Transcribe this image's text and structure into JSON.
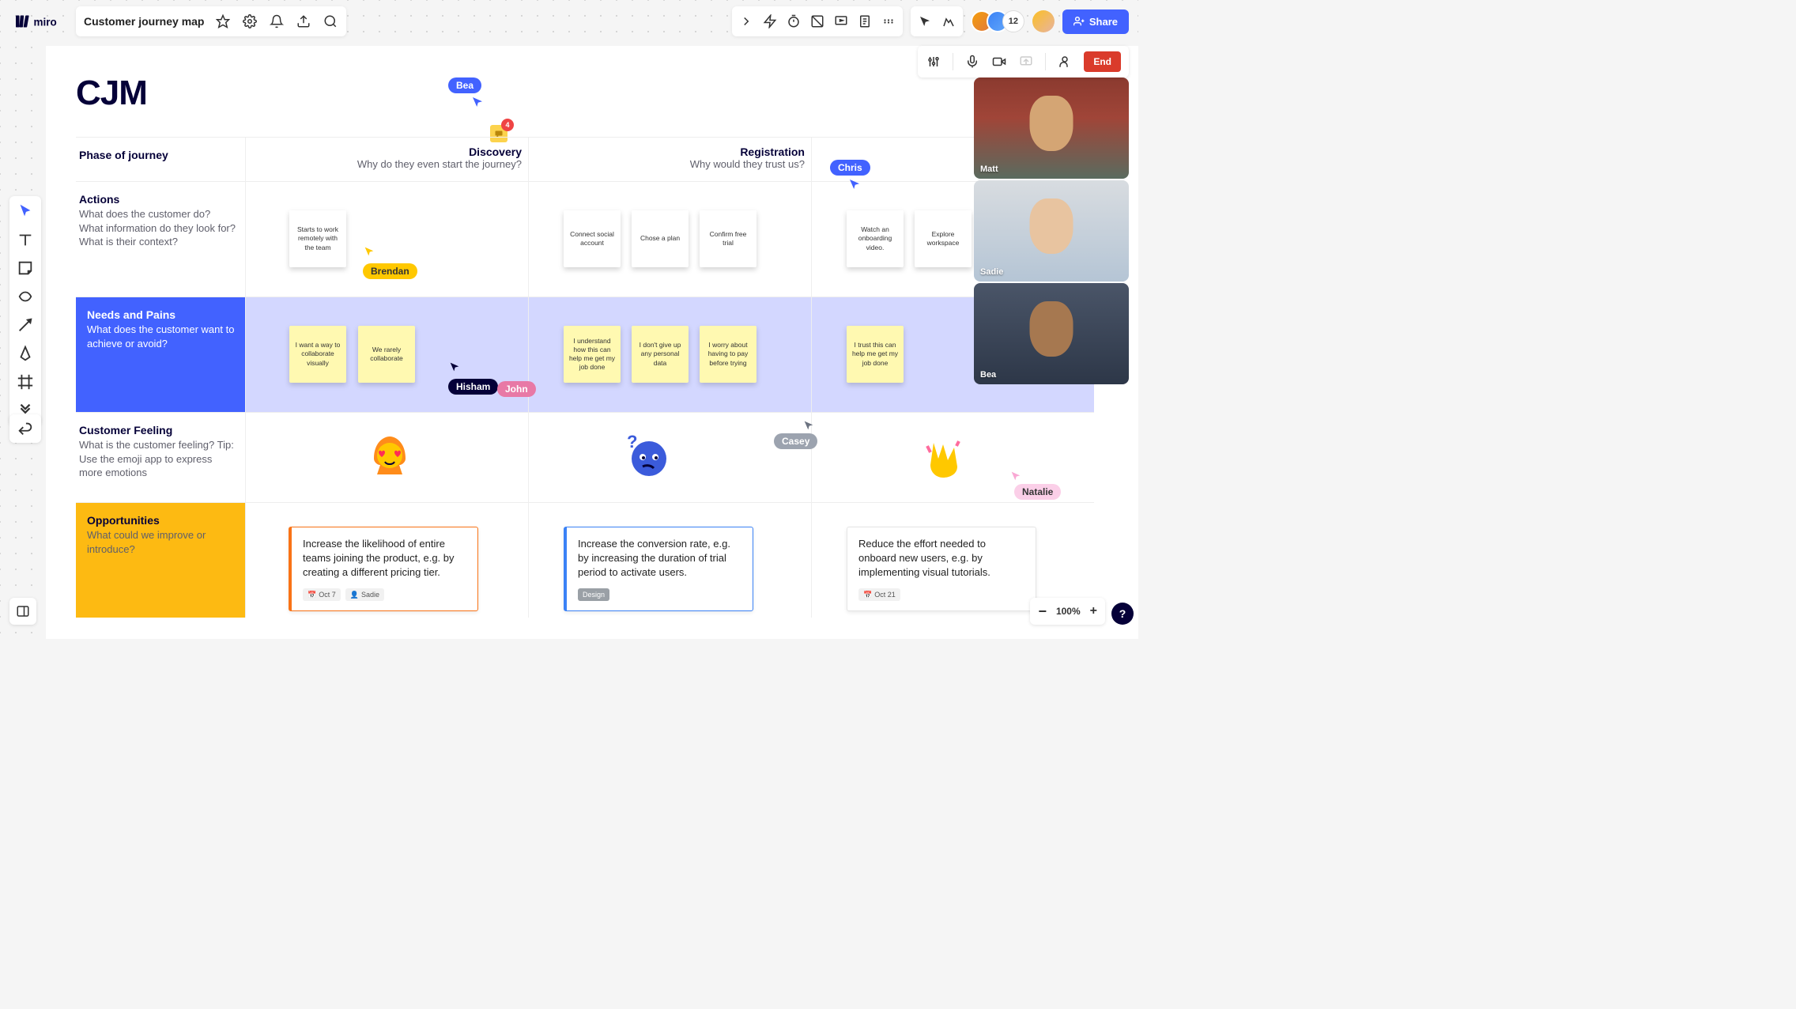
{
  "board": {
    "title": "Customer journey map"
  },
  "header": {
    "avatarCount": "12",
    "share": "Share"
  },
  "facilitator": {
    "end": "End"
  },
  "canvas": {
    "title": "CJM",
    "commentBadge": "4",
    "phases": {
      "label": "Phase of journey",
      "discovery": {
        "title": "Discovery",
        "sub": "Why do they even start the journey?"
      },
      "registration": {
        "title": "Registration",
        "sub": "Why would they trust us?"
      }
    },
    "rows": {
      "actions": {
        "title": "Actions",
        "sub": "What does the customer do? What information do they look for? What is their context?"
      },
      "needs": {
        "title": "Needs and Pains",
        "sub": "What does the customer want to achieve or avoid?"
      },
      "feeling": {
        "title": "Customer Feeling",
        "sub": "What is the customer feeling? Tip: Use the emoji app to express more emotions"
      },
      "opp": {
        "title": "Opportunities",
        "sub": "What could we improve or introduce?"
      }
    },
    "stickies": {
      "a1": "Starts to work remotely with the team",
      "a2": "Connect  social account",
      "a3": "Chose a plan",
      "a4": "Confirm free trial",
      "a5": "Watch an onboarding video.",
      "a6": "Explore workspace",
      "n1": "I want a way to collaborate visually",
      "n2": "We rarely collaborate",
      "n3": "I understand how this can help me get my job done",
      "n4": "I don't give up any personal data",
      "n5": "I worry about having to pay before trying",
      "n6": "I trust this can help me get my job done"
    },
    "opportunities": {
      "o1": {
        "text": "Increase the likelihood of entire teams joining the product, e.g. by creating a different pricing tier.",
        "date": "Oct 7",
        "owner": "Sadie"
      },
      "o2": {
        "text": "Increase the conversion rate, e.g. by increasing the duration of trial period to activate users.",
        "tag": "Design"
      },
      "o3": {
        "text": "Reduce the effort needed to onboard new users, e.g. by implementing visual tutorials.",
        "date": "Oct 21"
      }
    },
    "cursors": {
      "bea": "Bea",
      "chris": "Chris",
      "brendan": "Brendan",
      "hisham": "Hisham",
      "john": "John",
      "casey": "Casey",
      "natalie": "Natalie"
    }
  },
  "video": {
    "p1": "Matt",
    "p2": "Sadie",
    "p3": "Bea"
  },
  "zoom": {
    "level": "100%"
  }
}
